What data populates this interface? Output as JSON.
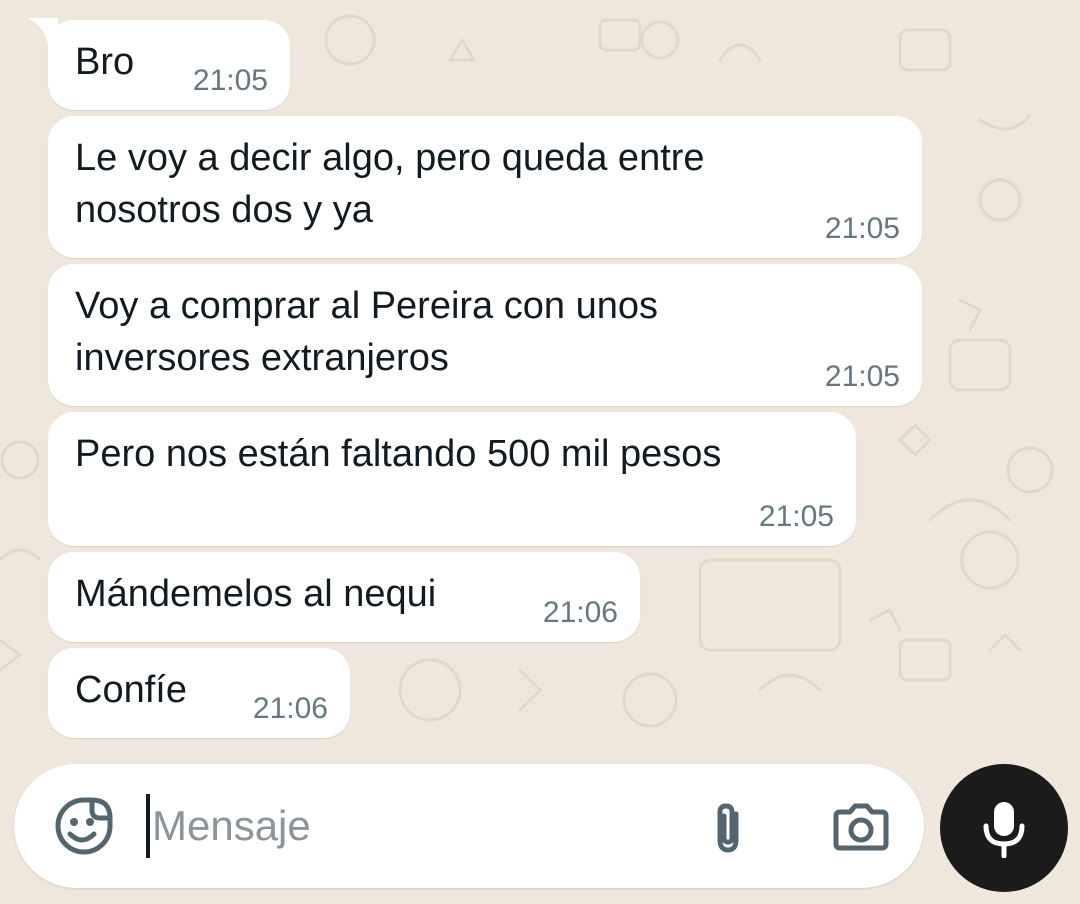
{
  "messages": [
    {
      "lines": [
        "Bro"
      ],
      "time": "21:05"
    },
    {
      "lines": [
        "Le voy a decir algo, pero queda entre",
        "nosotros dos y ya"
      ],
      "time": "21:05"
    },
    {
      "lines": [
        "Voy a comprar al Pereira con unos",
        "inversores extranjeros"
      ],
      "time": "21:05"
    },
    {
      "lines": [
        "Pero nos están faltando 500 mil pesos"
      ],
      "time": "21:05"
    },
    {
      "lines": [
        "Mándemelos al nequi"
      ],
      "time": "21:06"
    },
    {
      "lines": [
        "Confíe"
      ],
      "time": "21:06"
    }
  ],
  "composer": {
    "placeholder": "Mensaje",
    "icons": {
      "sticker": "sticker-emoji-icon",
      "attach": "paperclip-icon",
      "camera": "camera-icon",
      "send": "microphone-icon"
    }
  },
  "colors": {
    "wallpaper": "#efe7dc",
    "bubble": "#ffffff",
    "text": "#111b21",
    "timestamp": "#667781",
    "mic_button": "#1b1b1b"
  }
}
